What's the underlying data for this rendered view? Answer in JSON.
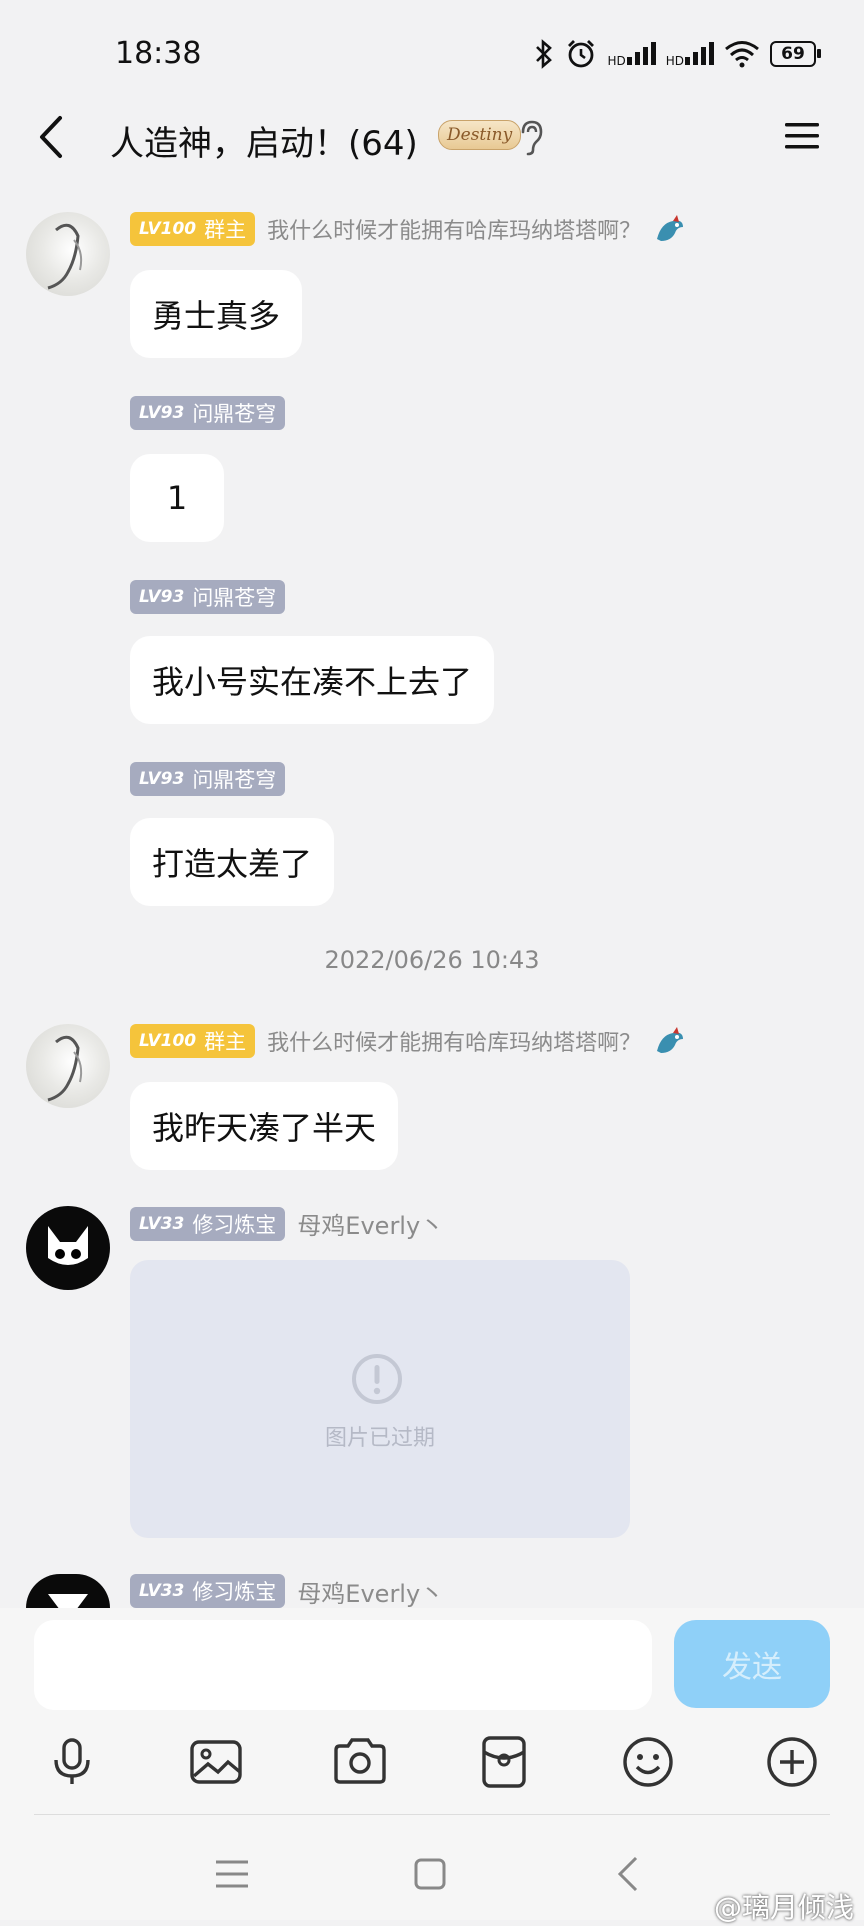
{
  "status_bar": {
    "time": "18:38",
    "signal_labels": [
      "HD",
      "HD"
    ],
    "battery": "69"
  },
  "header": {
    "title": "人造神，启动！",
    "member_count": "(64)",
    "badge_text": "Destiny"
  },
  "messages": [
    {
      "level": "LV100",
      "role": "群主",
      "title": "我什么时候才能拥有哈库玛纳塔塔啊？",
      "text": "勇士真多"
    },
    {
      "level": "LV93",
      "role": "问鼎苍穹",
      "text": "1"
    },
    {
      "level": "LV93",
      "role": "问鼎苍穹",
      "text": "我小号实在凑不上去了"
    },
    {
      "level": "LV93",
      "role": "问鼎苍穹",
      "text": "打造太差了"
    },
    {
      "level": "LV100",
      "role": "群主",
      "title": "我什么时候才能拥有哈库玛纳塔塔啊？",
      "text": "我昨天凑了半天"
    },
    {
      "level": "LV33",
      "role": "修习炼宝",
      "title": "母鸡Everly丶",
      "image_status": "图片已过期"
    },
    {
      "level": "LV33",
      "role": "修习炼宝",
      "title": "母鸡Everly丶"
    }
  ],
  "timestamp": "2022/06/26 10:43",
  "input": {
    "value": "",
    "send_label": "发送"
  },
  "toolbar": [
    "mic-icon",
    "image-icon",
    "camera-icon",
    "red-packet-icon",
    "emoji-icon",
    "plus-icon"
  ],
  "watermark": "@璃月倾浅",
  "colors": {
    "owner_tag": "#f5c43b",
    "member_tag": "#a6abbf",
    "send_button": "#8fd0f8",
    "background": "#f2f2f3"
  }
}
